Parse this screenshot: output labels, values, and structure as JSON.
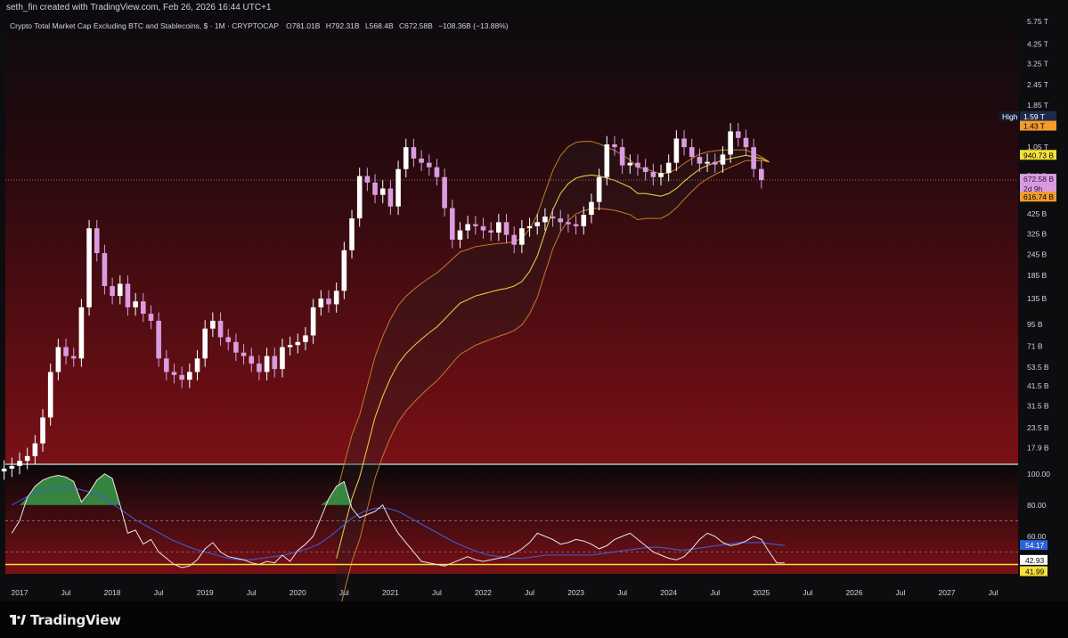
{
  "header": {
    "attribution": "seth_fin created with TradingView.com, Feb 26, 2026 16:44 UTC+1"
  },
  "legend": {
    "symbol_line": "Crypto Total Market Cap Excluding BTC and Stablecoins, $ · 1M · CRYPTOCAP",
    "o": "O781.01B",
    "h": "H792.31B",
    "l": "L568.4B",
    "c": "C672.58B",
    "chg": "−108.36B (−13.88%)"
  },
  "footer": {
    "brand": "TradingView"
  },
  "colors": {
    "bg_top": "#0d0b0e",
    "bg_bottom": "#7a1016",
    "candle_up": "#ffffff",
    "candle_down": "#d99ce0",
    "basis": "#e8c24a",
    "band_outer": "#c27a2c",
    "rsi_line": "#e8e8e8",
    "rsi_ma": "#3f5bd6",
    "rsi_fill": "#3a9a4a",
    "yellow_level": "#f5e13a",
    "orange_label": "#f29b2b",
    "high_label_bg": "#1e2a4a",
    "blue_label": "#2e62d9"
  },
  "chart_data": [
    {
      "type": "candlestick",
      "title": "Crypto Total Market Cap Excluding BTC and Stablecoins",
      "interval": "1M",
      "scale": "log",
      "ylim_billions": [
        14.5,
        6200
      ],
      "y_ticks": [
        {
          "label": "5.75 T",
          "value": 5750
        },
        {
          "label": "4.25 T",
          "value": 4250
        },
        {
          "label": "3.25 T",
          "value": 3250
        },
        {
          "label": "2.45 T",
          "value": 2450
        },
        {
          "label": "1.85 T",
          "value": 1850
        },
        {
          "label": "1.05 T",
          "value": 1050
        },
        {
          "label": "710 B",
          "value": 710
        },
        {
          "label": "425 B",
          "value": 425
        },
        {
          "label": "325 B",
          "value": 325
        },
        {
          "label": "245 B",
          "value": 245
        },
        {
          "label": "185 B",
          "value": 185
        },
        {
          "label": "135 B",
          "value": 135
        },
        {
          "label": "95 B",
          "value": 95
        },
        {
          "label": "71 B",
          "value": 71
        },
        {
          "label": "53.5 B",
          "value": 53.5
        },
        {
          "label": "41.5 B",
          "value": 41.5
        },
        {
          "label": "31.5 B",
          "value": 31.5
        },
        {
          "label": "23.5 B",
          "value": 23.5
        },
        {
          "label": "17.9 B",
          "value": 17.9
        }
      ],
      "x_ticks": [
        "2017",
        "Jul",
        "2018",
        "Jul",
        "2019",
        "Jul",
        "2020",
        "Jul",
        "2021",
        "Jul",
        "2022",
        "Jul",
        "2023",
        "Jul",
        "2024",
        "Jul",
        "2025",
        "Jul",
        "2026",
        "Jul",
        "2027",
        "Jul"
      ],
      "x_tick_dates": [
        "2017-01",
        "2017-07",
        "2018-01",
        "2018-07",
        "2019-01",
        "2019-07",
        "2020-01",
        "2020-07",
        "2021-01",
        "2021-07",
        "2022-01",
        "2022-07",
        "2023-01",
        "2023-07",
        "2024-01",
        "2024-07",
        "2025-01",
        "2025-07",
        "2026-01",
        "2026-07",
        "2027-01",
        "2027-07"
      ],
      "start_month": "2016-10",
      "closes_billions": [
        13,
        13.5,
        14,
        15,
        16,
        19,
        27,
        50,
        70,
        62,
        60,
        120,
        350,
        250,
        160,
        140,
        165,
        120,
        130,
        110,
        100,
        60,
        50,
        48,
        45,
        50,
        60,
        90,
        100,
        80,
        75,
        65,
        62,
        56,
        50,
        62,
        52,
        70,
        72,
        75,
        82,
        120,
        135,
        125,
        150,
        260,
        400,
        710,
        650,
        550,
        600,
        470,
        780,
        1050,
        900,
        850,
        800,
        700,
        460,
        300,
        340,
        370,
        360,
        340,
        330,
        380,
        320,
        280,
        350,
        360,
        380,
        410,
        400,
        380,
        370,
        360,
        420,
        500,
        700,
        1090,
        1050,
        820,
        850,
        800,
        750,
        700,
        740,
        850,
        1180,
        1050,
        920,
        840,
        860,
        830,
        950,
        1300,
        1190,
        1050,
        781,
        672.58
      ],
      "bb_basis_billions": [
        4,
        6,
        9,
        12,
        18,
        27,
        36,
        46,
        56,
        64,
        71,
        78,
        85,
        92,
        102,
        114,
        127,
        133,
        140,
        144,
        148,
        152,
        155,
        160,
        170,
        195,
        240,
        330,
        450,
        560,
        640,
        690,
        710,
        720,
        710,
        690,
        670,
        640,
        610,
        560,
        560,
        550,
        540,
        560,
        600,
        660,
        720,
        780,
        820,
        850,
        880,
        900,
        920,
        940.73,
        920,
        900,
        860
      ],
      "price_labels": [
        {
          "text": "High",
          "value": 1590
        },
        {
          "text": "1.59 T",
          "value": 1590
        },
        {
          "text": "1.43 T",
          "value": 1430
        },
        {
          "text": "940.73 B",
          "value": 940.73
        },
        {
          "text": "672.58 B",
          "value": 672.58
        },
        {
          "text": "2d 9h",
          "value": 672.58
        },
        {
          "text": "616.74 B",
          "value": 616.74
        }
      ]
    },
    {
      "type": "line",
      "title": "RSI",
      "ylim": [
        36,
        105
      ],
      "y_ticks": [
        100,
        80,
        60
      ],
      "levels": [
        70,
        50
      ],
      "current_values": [
        {
          "label": "54.17",
          "value": 54.17
        },
        {
          "label": "42.93",
          "value": 42.93
        },
        {
          "label": "41.99",
          "value": 41.99
        }
      ],
      "series": [
        {
          "values": [
            62,
            70,
            85,
            92,
            96,
            98,
            99,
            98,
            95,
            82,
            88,
            96,
            100,
            97,
            80,
            62,
            64,
            55,
            58,
            50,
            46,
            42,
            40,
            41,
            45,
            52,
            56,
            50,
            47,
            46,
            45,
            43,
            42,
            44,
            43,
            48,
            44,
            51,
            55,
            60,
            72,
            84,
            92,
            95,
            78,
            72,
            74,
            76,
            80,
            70,
            62,
            56,
            50,
            44,
            43,
            42,
            41,
            43,
            45,
            47,
            45,
            44,
            45,
            46,
            47,
            49,
            52,
            56,
            62,
            60,
            58,
            55,
            56,
            58,
            57,
            55,
            52,
            54,
            58,
            60,
            62,
            58,
            54,
            50,
            48,
            46,
            45,
            47,
            52,
            58,
            62,
            60,
            56,
            54,
            55,
            57,
            60,
            58,
            50,
            43,
            42.93
          ]
        },
        {
          "values": [
            80,
            84,
            88,
            90,
            91,
            91,
            90,
            88,
            85,
            80,
            75,
            70,
            66,
            62,
            58,
            55,
            52,
            50,
            48,
            46,
            45,
            45,
            46,
            47,
            48,
            50,
            52,
            55,
            60,
            66,
            72,
            76,
            78,
            78,
            76,
            72,
            68,
            64,
            60,
            56,
            53,
            50,
            48,
            47,
            46,
            46,
            47,
            48,
            48,
            48,
            48,
            48,
            49,
            50,
            51,
            52,
            53,
            53,
            52,
            51,
            52,
            53,
            54,
            55,
            56,
            56,
            56,
            55,
            54.17
          ]
        }
      ]
    }
  ]
}
